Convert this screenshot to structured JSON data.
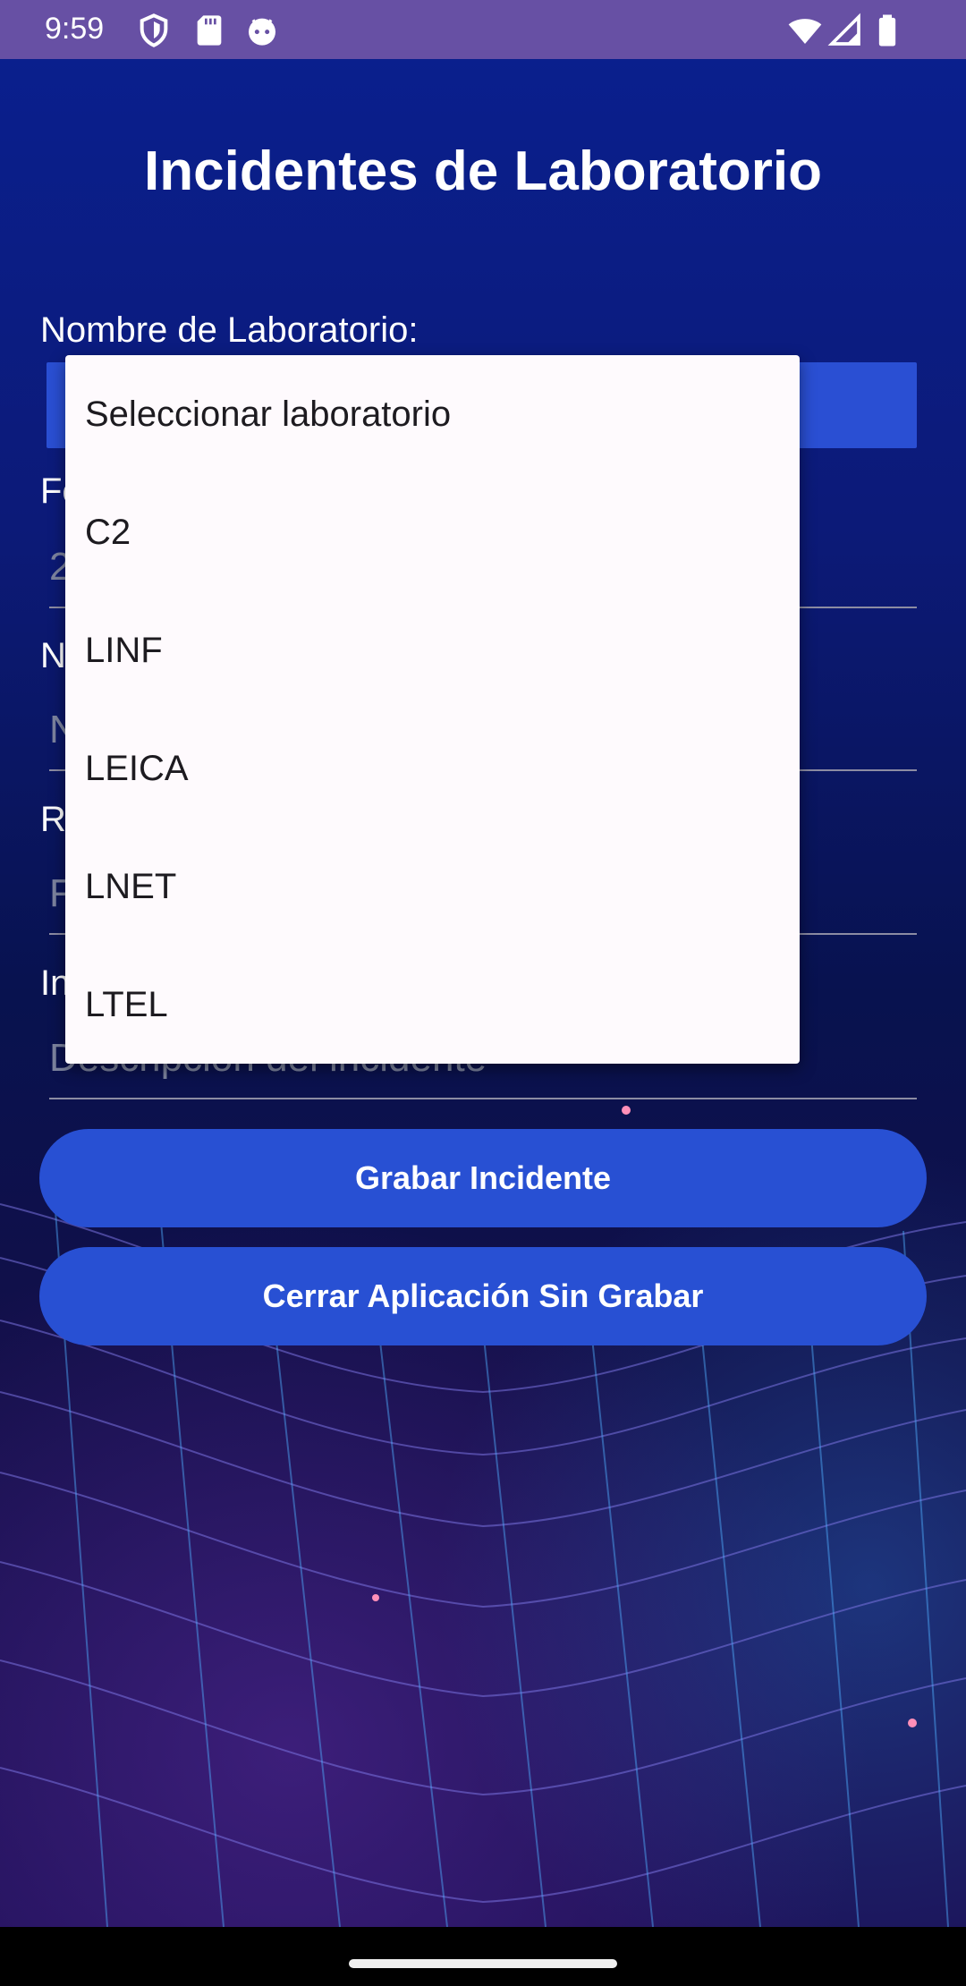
{
  "status_bar": {
    "time": "9:59",
    "icons": [
      "shield-icon",
      "sd-card-icon",
      "android-icon",
      "wifi-icon",
      "signal-icon",
      "battery-icon"
    ]
  },
  "app": {
    "title": "Incidentes de Laboratorio",
    "colors": {
      "status_bar": "#6750a4",
      "button": "#2850d3",
      "spinner": "#2a4fd3",
      "dropdown_bg": "#fefafd"
    }
  },
  "form": {
    "lab_label": "Nombre de Laboratorio:",
    "fecha_label_partial": "Fe",
    "fecha_value_partial": "2",
    "nombre_label_partial": "N",
    "nombre_placeholder_partial": "N",
    "responsable_label_partial": "R",
    "responsable_placeholder_partial": "F",
    "incidente_label_partial": "In",
    "incidente_placeholder": "Descripción del incidente"
  },
  "buttons": {
    "save": "Grabar Incidente",
    "close": "Cerrar Aplicación Sin Grabar"
  },
  "dropdown": {
    "items": [
      "Seleccionar laboratorio",
      "C2",
      "LINF",
      "LEICA",
      "LNET",
      "LTEL"
    ]
  }
}
